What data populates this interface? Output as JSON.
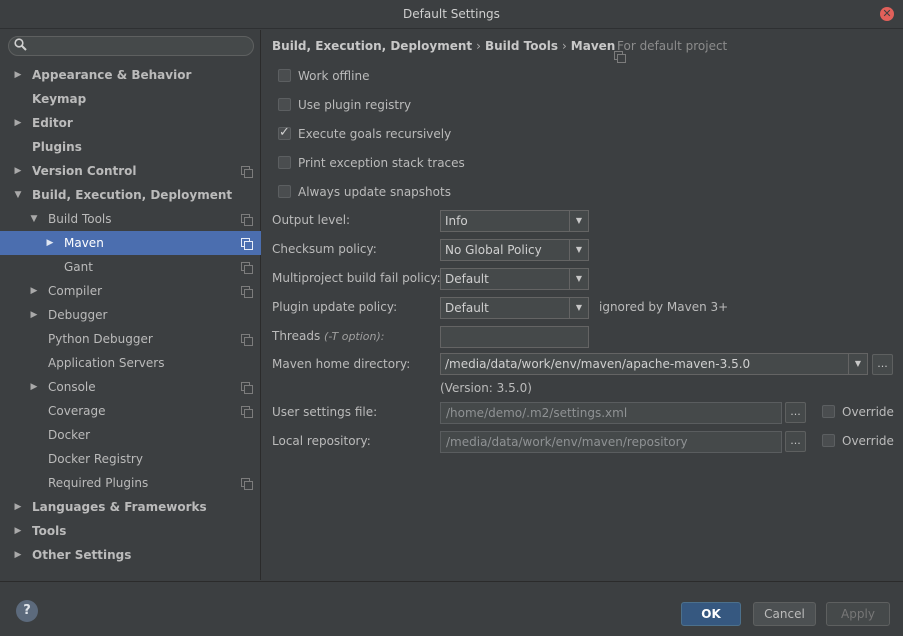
{
  "window": {
    "title": "Default Settings",
    "close_icon": "✕"
  },
  "search": {
    "placeholder": "",
    "icon": "search-icon"
  },
  "tree": [
    {
      "label": "Appearance & Behavior",
      "level": 0,
      "arrow": "▶",
      "bold": true
    },
    {
      "label": "Keymap",
      "level": 0,
      "arrow": "",
      "bold": true
    },
    {
      "label": "Editor",
      "level": 0,
      "arrow": "▶",
      "bold": true
    },
    {
      "label": "Plugins",
      "level": 0,
      "arrow": "",
      "bold": true
    },
    {
      "label": "Version Control",
      "level": 0,
      "arrow": "▶",
      "bold": true,
      "copy": true
    },
    {
      "label": "Build, Execution, Deployment",
      "level": 0,
      "arrow": "▼",
      "bold": true
    },
    {
      "label": "Build Tools",
      "level": 1,
      "arrow": "▼",
      "copy": true
    },
    {
      "label": "Maven",
      "level": 2,
      "arrow": "▶",
      "selected": true,
      "copy": true
    },
    {
      "label": "Gant",
      "level": 2,
      "arrow": "",
      "copy": true
    },
    {
      "label": "Compiler",
      "level": 1,
      "arrow": "▶",
      "copy": true
    },
    {
      "label": "Debugger",
      "level": 1,
      "arrow": "▶"
    },
    {
      "label": "Python Debugger",
      "level": 1,
      "arrow": "",
      "copy": true
    },
    {
      "label": "Application Servers",
      "level": 1,
      "arrow": ""
    },
    {
      "label": "Console",
      "level": 1,
      "arrow": "▶",
      "copy": true
    },
    {
      "label": "Coverage",
      "level": 1,
      "arrow": "",
      "copy": true
    },
    {
      "label": "Docker",
      "level": 1,
      "arrow": ""
    },
    {
      "label": "Docker Registry",
      "level": 1,
      "arrow": ""
    },
    {
      "label": "Required Plugins",
      "level": 1,
      "arrow": "",
      "copy": true
    },
    {
      "label": "Languages & Frameworks",
      "level": 0,
      "arrow": "▶",
      "bold": true
    },
    {
      "label": "Tools",
      "level": 0,
      "arrow": "▶",
      "bold": true
    },
    {
      "label": "Other Settings",
      "level": 0,
      "arrow": "▶",
      "bold": true
    }
  ],
  "breadcrumb": {
    "part1": "Build, Execution, Deployment",
    "sep": "›",
    "part2": "Build Tools",
    "part3": "Maven",
    "scope": "For default project"
  },
  "checkboxes": [
    {
      "label": "Work offline",
      "checked": false
    },
    {
      "label": "Use plugin registry",
      "checked": false
    },
    {
      "label": "Execute goals recursively",
      "checked": true
    },
    {
      "label": "Print exception stack traces",
      "checked": false
    },
    {
      "label": "Always update snapshots",
      "checked": false
    }
  ],
  "form": {
    "output_level": {
      "label": "Output level:",
      "value": "Info"
    },
    "checksum_policy": {
      "label": "Checksum policy:",
      "value": "No Global Policy"
    },
    "multiproject_fail_policy": {
      "label": "Multiproject build fail policy:",
      "value": "Default"
    },
    "plugin_update_policy": {
      "label": "Plugin update policy:",
      "value": "Default",
      "note": "ignored by Maven 3+"
    },
    "threads": {
      "label": "Threads",
      "option": "(-T option):",
      "value": ""
    },
    "maven_home": {
      "label": "Maven home directory:",
      "value": "/media/data/work/env/maven/apache-maven-3.5.0",
      "version": "(Version: 3.5.0)"
    },
    "user_settings": {
      "label": "User settings file:",
      "value": "/home/demo/.m2/settings.xml",
      "override": "Override"
    },
    "local_repository": {
      "label": "Local repository:",
      "value": "/media/data/work/env/maven/repository",
      "override": "Override"
    },
    "ellipsis": "...",
    "dropdown_arrow": "▼"
  },
  "footer": {
    "help": "?",
    "ok": "OK",
    "cancel": "Cancel",
    "apply": "Apply"
  },
  "colors": {
    "background": "#3c3f41",
    "selection": "#4b6eaf",
    "primary_button": "#365880"
  }
}
